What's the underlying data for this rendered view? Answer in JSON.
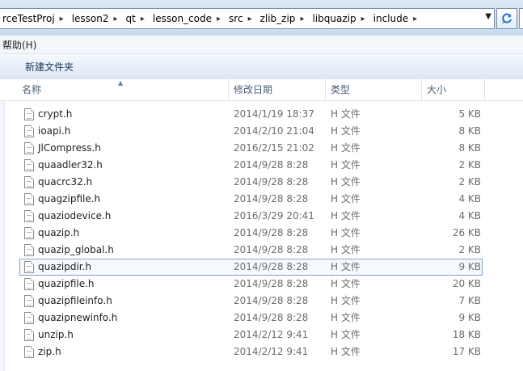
{
  "address_bar": {
    "crumbs": [
      "rceTestProj",
      "lesson2",
      "qt",
      "lesson_code",
      "src",
      "zlib_zip",
      "libquazip",
      "include"
    ]
  },
  "menu": {
    "help": "帮助(H)"
  },
  "toolbar": {
    "new_folder": "新建文件夹"
  },
  "columns": {
    "name": "名称",
    "date": "修改日期",
    "type": "类型",
    "size": "大小"
  },
  "files": [
    {
      "name": "crypt.h",
      "date": "2014/1/19 18:37",
      "type": "H 文件",
      "size": "5 KB"
    },
    {
      "name": "ioapi.h",
      "date": "2014/2/10 21:04",
      "type": "H 文件",
      "size": "8 KB"
    },
    {
      "name": "JlCompress.h",
      "date": "2016/2/15 21:02",
      "type": "H 文件",
      "size": "8 KB"
    },
    {
      "name": "quaadler32.h",
      "date": "2014/9/28 8:28",
      "type": "H 文件",
      "size": "2 KB"
    },
    {
      "name": "quacrc32.h",
      "date": "2014/9/28 8:28",
      "type": "H 文件",
      "size": "2 KB"
    },
    {
      "name": "quagzipfile.h",
      "date": "2014/9/28 8:28",
      "type": "H 文件",
      "size": "4 KB"
    },
    {
      "name": "quaziodevice.h",
      "date": "2016/3/29 20:41",
      "type": "H 文件",
      "size": "4 KB"
    },
    {
      "name": "quazip.h",
      "date": "2014/9/28 8:28",
      "type": "H 文件",
      "size": "26 KB"
    },
    {
      "name": "quazip_global.h",
      "date": "2014/9/28 8:28",
      "type": "H 文件",
      "size": "2 KB"
    },
    {
      "name": "quazipdir.h",
      "date": "2014/9/28 8:28",
      "type": "H 文件",
      "size": "9 KB",
      "selected": true
    },
    {
      "name": "quazipfile.h",
      "date": "2014/9/28 8:28",
      "type": "H 文件",
      "size": "20 KB"
    },
    {
      "name": "quazipfileinfo.h",
      "date": "2014/9/28 8:28",
      "type": "H 文件",
      "size": "7 KB"
    },
    {
      "name": "quazipnewinfo.h",
      "date": "2014/9/28 8:28",
      "type": "H 文件",
      "size": "9 KB"
    },
    {
      "name": "unzip.h",
      "date": "2014/2/12 9:41",
      "type": "H 文件",
      "size": "18 KB"
    },
    {
      "name": "zip.h",
      "date": "2014/2/12 9:41",
      "type": "H 文件",
      "size": "17 KB"
    }
  ],
  "icons": {
    "file": "header-file-icon",
    "refresh": "refresh-icon",
    "dropdown": "chevron-down-icon",
    "sort": "sort-ascending-icon"
  },
  "colors": {
    "accent": "#7da2ce",
    "header_text": "#4c607a"
  }
}
